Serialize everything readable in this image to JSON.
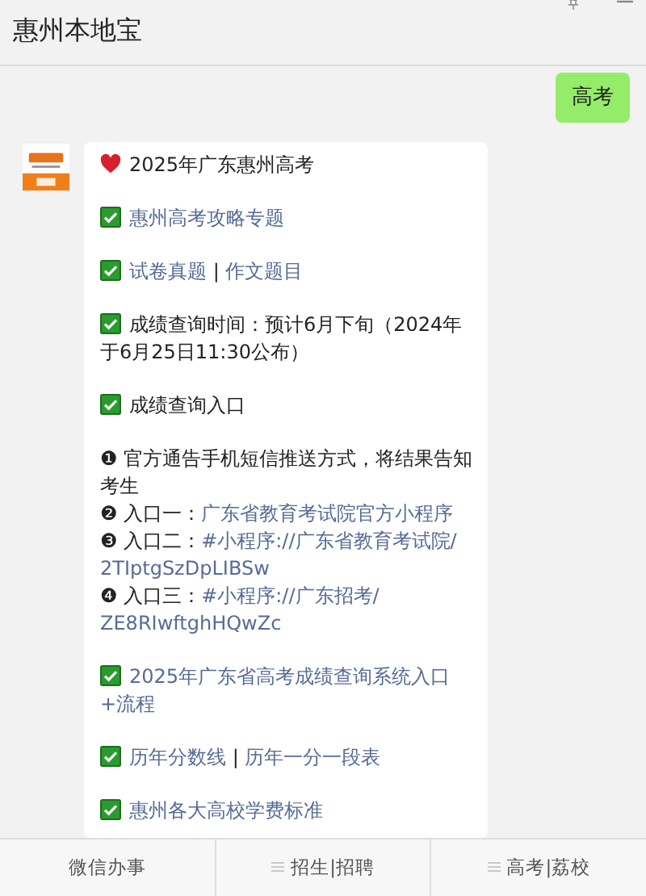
{
  "header": {
    "title": "惠州本地宝"
  },
  "sent_message": {
    "text": "高考"
  },
  "reply": {
    "paragraphs": [
      {
        "lines": [
          {
            "kind": "heart",
            "parts": [
              {
                "text": "2025年广东惠州高考",
                "link": false
              }
            ]
          }
        ]
      },
      {
        "lines": [
          {
            "kind": "check",
            "parts": [
              {
                "text": "惠州高考攻略专题",
                "link": true
              }
            ]
          }
        ]
      },
      {
        "lines": [
          {
            "kind": "check",
            "parts": [
              {
                "text": "试卷真题",
                "link": true
              },
              {
                "text": " | ",
                "link": false
              },
              {
                "text": "作文题目",
                "link": true
              }
            ]
          }
        ]
      },
      {
        "lines": [
          {
            "kind": "check",
            "parts": [
              {
                "text": "成绩查询时间：预计6月下旬（2024年",
                "link": false
              }
            ]
          },
          {
            "kind": "plain",
            "parts": [
              {
                "text": "于6月25日11:30公布）",
                "link": false
              }
            ]
          }
        ]
      },
      {
        "lines": [
          {
            "kind": "check",
            "parts": [
              {
                "text": "成绩查询入口",
                "link": false
              }
            ]
          }
        ]
      },
      {
        "lines": [
          {
            "kind": "plain",
            "parts": [
              {
                "text": "❶ 官方通告手机短信推送方式，将结果告知",
                "link": false
              }
            ]
          },
          {
            "kind": "plain",
            "parts": [
              {
                "text": "考生",
                "link": false
              }
            ]
          },
          {
            "kind": "plain",
            "parts": [
              {
                "text": "❷ 入口一：",
                "link": false
              },
              {
                "text": "广东省教育考试院官方小程序",
                "link": true
              }
            ]
          },
          {
            "kind": "plain",
            "parts": [
              {
                "text": "❸ 入口二：",
                "link": false
              },
              {
                "text": "#小程序://广东省教育考试院/",
                "link": true
              }
            ]
          },
          {
            "kind": "plain",
            "parts": [
              {
                "text": "2TIptgSzDpLIBSw",
                "link": true
              }
            ]
          },
          {
            "kind": "plain",
            "parts": [
              {
                "text": "❹ 入口三：",
                "link": false
              },
              {
                "text": "#小程序://广东招考/",
                "link": true
              }
            ]
          },
          {
            "kind": "plain",
            "parts": [
              {
                "text": "ZE8RIwftghHQwZc",
                "link": true
              }
            ]
          }
        ]
      },
      {
        "lines": [
          {
            "kind": "check",
            "parts": [
              {
                "text": "2025年广东省高考成绩查询系统入口",
                "link": true
              }
            ]
          },
          {
            "kind": "plain",
            "parts": [
              {
                "text": "+流程",
                "link": true
              }
            ]
          }
        ]
      },
      {
        "lines": [
          {
            "kind": "check",
            "parts": [
              {
                "text": "历年分数线",
                "link": true
              },
              {
                "text": " | ",
                "link": false
              },
              {
                "text": "历年一分一段表",
                "link": true
              }
            ]
          }
        ]
      },
      {
        "lines": [
          {
            "kind": "check",
            "parts": [
              {
                "text": "惠州各大高校学费标准",
                "link": true
              }
            ]
          }
        ]
      }
    ]
  },
  "menu": [
    {
      "label": "微信办事",
      "has_submenu": false
    },
    {
      "label": "招生|招聘",
      "has_submenu": true
    },
    {
      "label": "高考|荔校",
      "has_submenu": true
    }
  ]
}
